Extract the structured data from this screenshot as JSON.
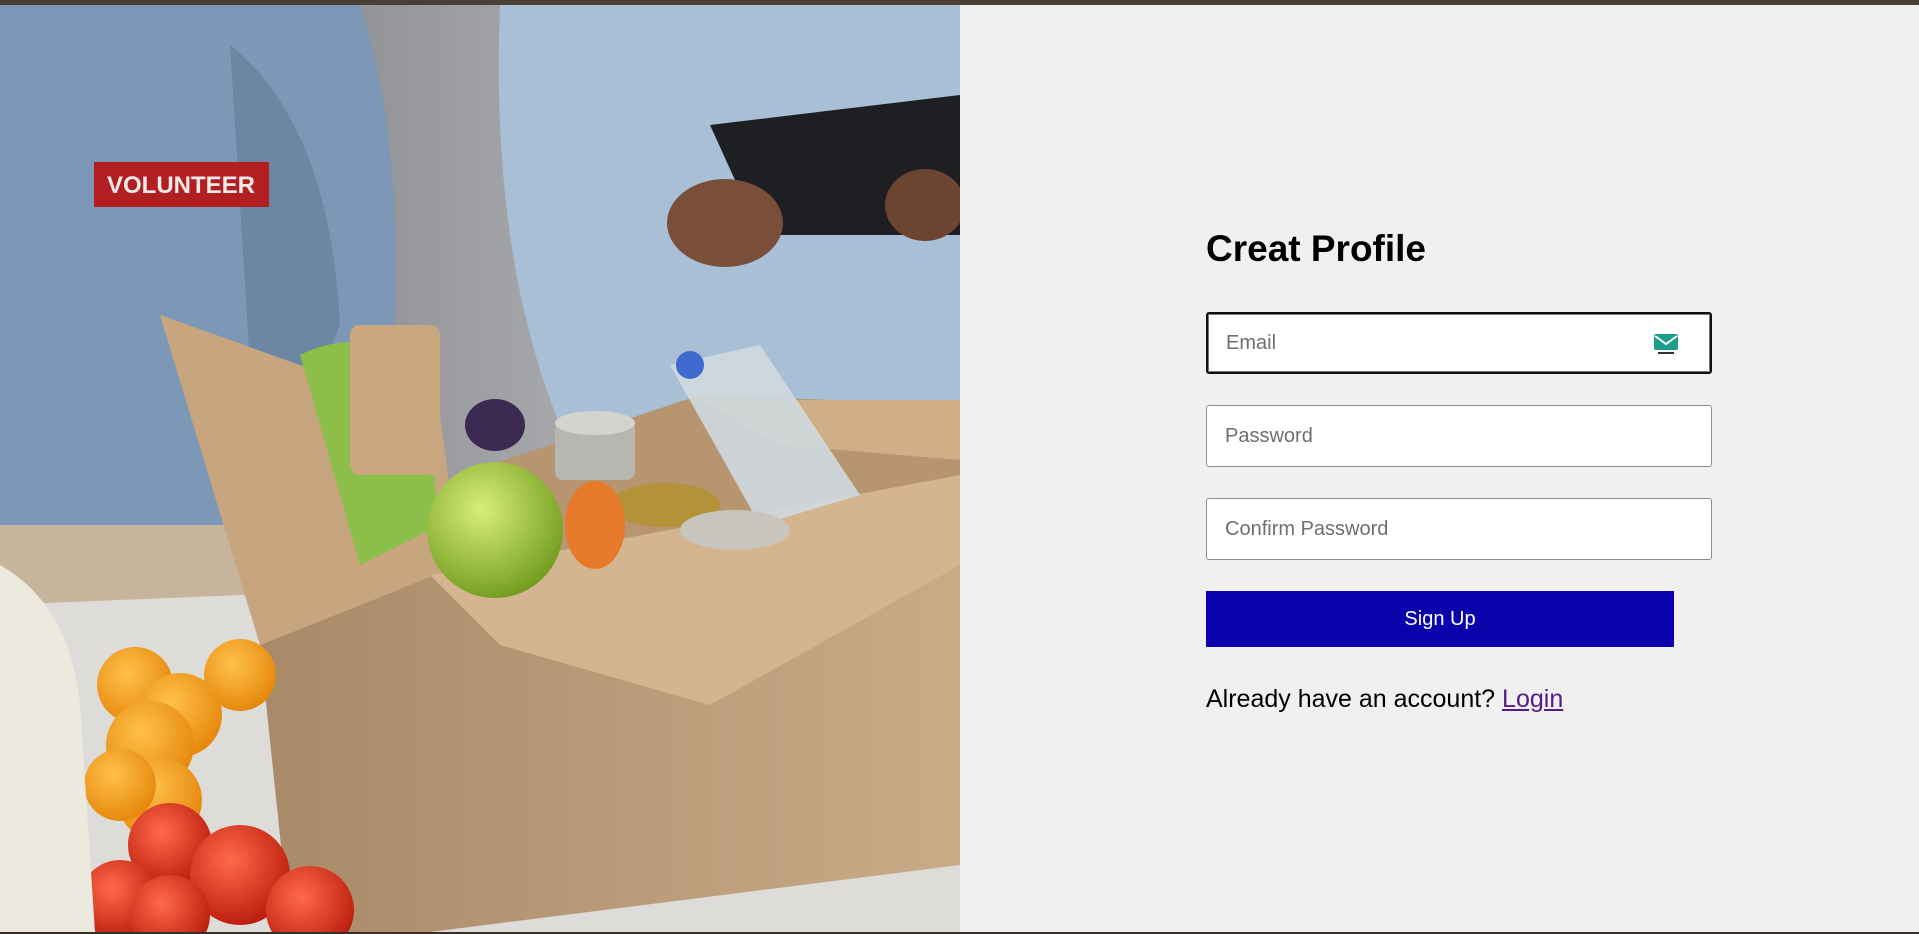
{
  "colors": {
    "accent": "#0a03ac",
    "link": "#551a8b",
    "panel_bg": "#f0f0f0",
    "topbar": "#4a3f35"
  },
  "hero": {
    "badge_text": "VOLUNTEER"
  },
  "form": {
    "title": "Creat Profile",
    "email": {
      "placeholder": "Email",
      "value": "",
      "icon": "mail-icon"
    },
    "password": {
      "placeholder": "Password",
      "value": ""
    },
    "confirm_password": {
      "placeholder": "Confirm Password",
      "value": ""
    },
    "submit_label": "Sign Up",
    "login_prompt": "Already have an account?",
    "login_link": "Login"
  }
}
